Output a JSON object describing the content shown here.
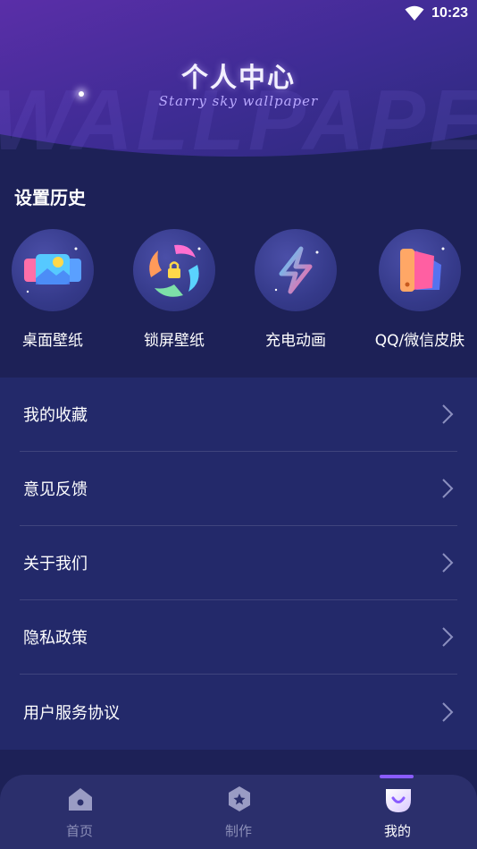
{
  "status_bar": {
    "time": "10:23",
    "wifi_icon": "wifi-icon"
  },
  "header": {
    "title": "个人中心",
    "subtitle": "Starry sky wallpaper",
    "watermark": "WALLPAPER"
  },
  "history": {
    "title": "设置历史",
    "items": [
      {
        "label": "桌面壁纸",
        "icon": "desktop-wallpaper-icon"
      },
      {
        "label": "锁屏壁纸",
        "icon": "lock-screen-icon"
      },
      {
        "label": "充电动画",
        "icon": "charging-bolt-icon"
      },
      {
        "label": "QQ/微信皮肤",
        "icon": "palette-icon"
      }
    ]
  },
  "menu": {
    "items": [
      {
        "label": "我的收藏"
      },
      {
        "label": "意见反馈"
      },
      {
        "label": "关于我们"
      },
      {
        "label": "隐私政策"
      },
      {
        "label": "用户服务协议"
      }
    ]
  },
  "bottom_nav": {
    "items": [
      {
        "label": "首页",
        "icon": "home-icon",
        "active": false
      },
      {
        "label": "制作",
        "icon": "create-icon",
        "active": false
      },
      {
        "label": "我的",
        "icon": "profile-icon",
        "active": true
      }
    ]
  },
  "colors": {
    "background": "#1d2157",
    "menu_background": "#23296a",
    "accent": "#8a5cff",
    "nav_inactive": "#8c8fb8"
  }
}
